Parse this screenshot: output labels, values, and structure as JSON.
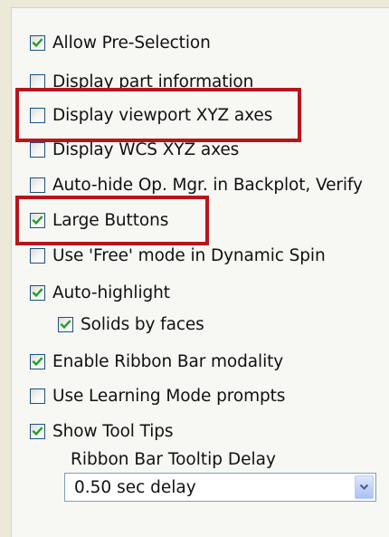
{
  "options": [
    {
      "label": "Allow Pre-Selection",
      "checked": true
    },
    {
      "label": "Display part information",
      "checked": false
    },
    {
      "label": "Display viewport XYZ axes",
      "checked": false
    },
    {
      "label": "Display WCS XYZ axes",
      "checked": false
    },
    {
      "label": "Auto-hide Op. Mgr. in Backplot, Verify",
      "checked": false
    },
    {
      "label": "Large Buttons",
      "checked": true
    },
    {
      "label": "Use 'Free' mode in Dynamic Spin",
      "checked": false
    },
    {
      "label": "Auto-highlight",
      "checked": true
    },
    {
      "label": "Solids by faces",
      "checked": true
    },
    {
      "label": "Enable Ribbon Bar modality",
      "checked": true
    },
    {
      "label": "Use Learning Mode prompts",
      "checked": false
    },
    {
      "label": "Show Tool Tips",
      "checked": true
    }
  ],
  "tooltip_delay": {
    "label": "Ribbon Bar Tooltip Delay",
    "selected": "0.50 sec delay"
  },
  "colors": {
    "highlight_box": "#b8151b",
    "checkmark": "#21a121",
    "checkbox_border": "#1c5180"
  },
  "icons": {
    "check": "checkmark-icon",
    "dropdown": "chevron-down-icon"
  }
}
